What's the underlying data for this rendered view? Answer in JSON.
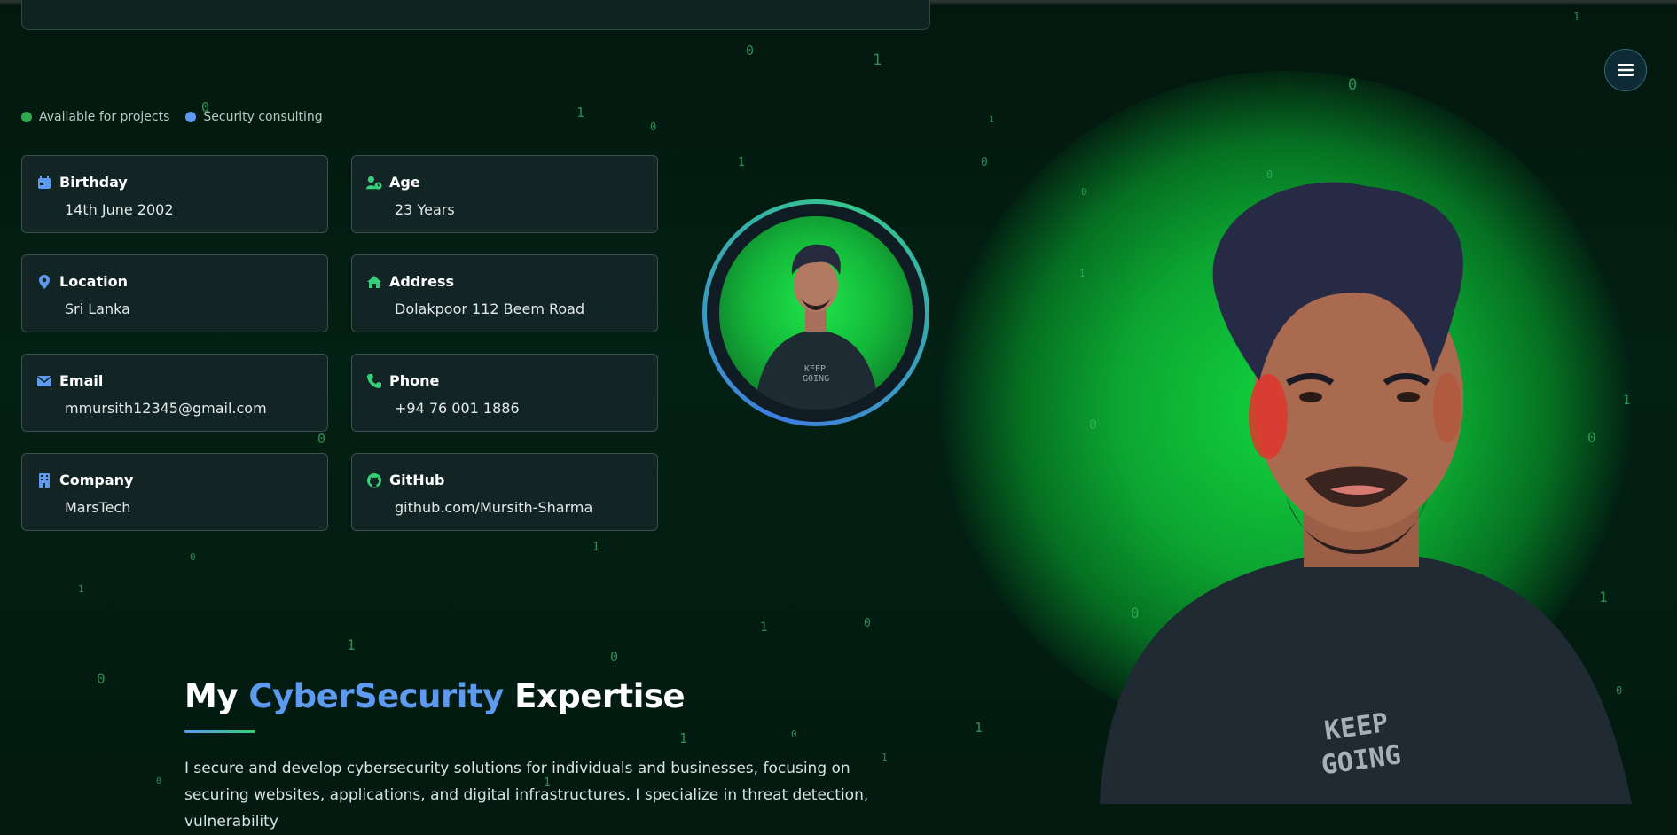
{
  "status": {
    "items": [
      {
        "label": "Available for projects",
        "color": "#2fa84f"
      },
      {
        "label": "Security consulting",
        "color": "#5d9af0"
      }
    ]
  },
  "info_cards": [
    {
      "title": "Birthday",
      "value": "14th June 2002",
      "icon": "calendar-icon"
    },
    {
      "title": "Age",
      "value": "23 Years",
      "icon": "user-clock-icon"
    },
    {
      "title": "Location",
      "value": "Sri Lanka",
      "icon": "map-pin-icon"
    },
    {
      "title": "Address",
      "value": "Dolakpoor 112 Beem Road",
      "icon": "home-icon"
    },
    {
      "title": "Email",
      "value": "mmursith12345@gmail.com",
      "icon": "envelope-icon"
    },
    {
      "title": "Phone",
      "value": "+94 76 001 1886",
      "icon": "phone-icon"
    },
    {
      "title": "Company",
      "value": "MarsTech",
      "icon": "building-icon"
    },
    {
      "title": "GitHub",
      "value": "github.com/Mursith-Sharma",
      "icon": "github-icon"
    }
  ],
  "expertise": {
    "title_pre": "My",
    "title_accent": "CyberSecurity",
    "title_post": "Expertise",
    "paragraph": "I secure and develop cybersecurity solutions for individuals and businesses, focusing on securing websites, applications, and digital infrastructures. I specialize in threat detection, vulnerability"
  },
  "matrix_digits": [
    "0",
    "1",
    "0",
    "1",
    "0",
    "1",
    "0",
    "1",
    "0",
    "1",
    "0",
    "1",
    "0",
    "0",
    "1",
    "1",
    "0",
    "1",
    "0",
    "1",
    "0",
    "1",
    "0",
    "1",
    "0",
    "1",
    "1",
    "0",
    "1",
    "0",
    "1",
    "1",
    "0",
    "0",
    "1",
    "0",
    "1",
    "1",
    "0",
    "1",
    "1",
    "0",
    "1",
    "0",
    "0",
    "1",
    "0",
    "1"
  ],
  "colors": {
    "accent_blue": "#5d9af0",
    "accent_green": "#34d07a",
    "icon_blue": "#5d9af0",
    "icon_green": "#34d07a",
    "background": "#021a10"
  }
}
